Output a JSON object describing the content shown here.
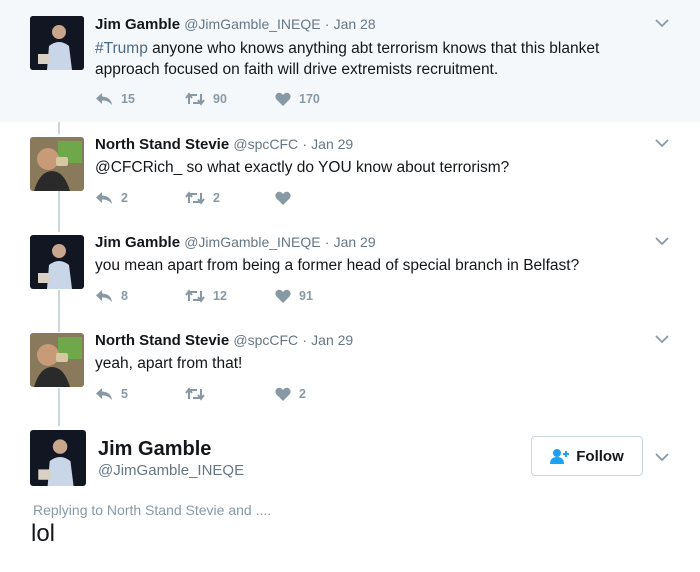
{
  "tweets": [
    {
      "name": "Jim Gamble",
      "handle": "@JimGamble_INEQE",
      "date": "Jan 28",
      "hashtag": "#Trump",
      "text": " anyone who knows anything abt terrorism knows that this blanket approach focused on faith will drive extremists recruitment.",
      "replies": "15",
      "retweets": "90",
      "likes": "170"
    },
    {
      "name": "North Stand Stevie",
      "handle": "@spcCFC",
      "date": "Jan 29",
      "text": "@CFCRich_ so what exactly do YOU know about terrorism?",
      "replies": "2",
      "retweets": "2",
      "likes": ""
    },
    {
      "name": "Jim Gamble",
      "handle": "@JimGamble_INEQE",
      "date": "Jan 29",
      "text": "you mean apart from being a former head of special branch in Belfast?",
      "replies": "8",
      "retweets": "12",
      "likes": "91"
    },
    {
      "name": "North Stand Stevie",
      "handle": "@spcCFC",
      "date": "Jan 29",
      "text": "yeah, apart from that!",
      "replies": "5",
      "retweets": "",
      "likes": "2"
    }
  ],
  "reply_card": {
    "name": "Jim Gamble",
    "handle": "@JimGamble_INEQE",
    "follow_label": "Follow",
    "replying_to": "Replying to North Stand Stevie and ....",
    "text": "lol"
  },
  "separator": "·",
  "colors": {
    "icon": "#8899a6",
    "text": "#14171a",
    "muted": "#657786",
    "highlight_bg": "#f5f8fa",
    "follow_icon": "#1da1f2"
  }
}
